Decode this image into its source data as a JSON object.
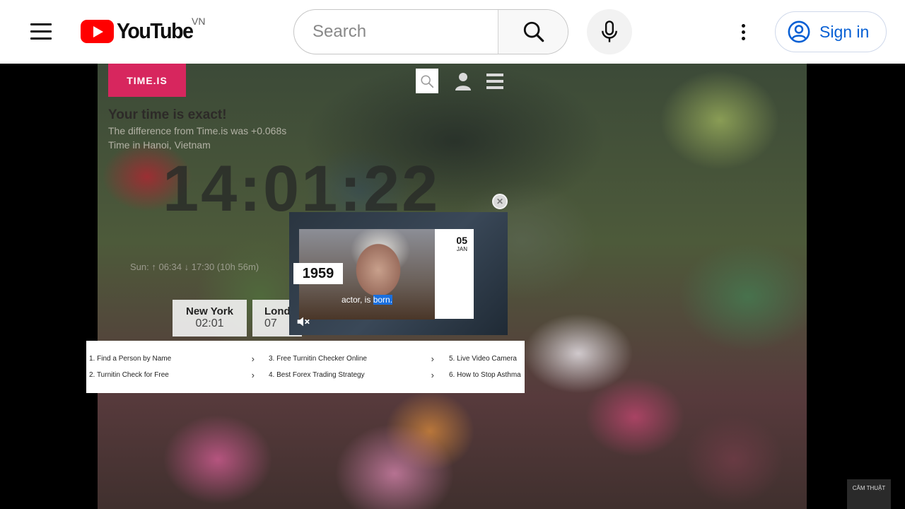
{
  "header": {
    "logo_text": "YouTube",
    "country_code": "VN",
    "search_placeholder": "Search",
    "signin_label": "Sign in"
  },
  "timeis": {
    "logo_label": "TIME.IS",
    "headline": "Your time is exact!",
    "difference_text": "The difference from Time.is was +0.068s",
    "location_text": "Time in Hanoi, Vietnam",
    "clock": "14:01:22",
    "sun_text": "Sun: ↑ 06:34 ↓ 17:30 (10h 56m)",
    "cities": [
      {
        "name": "New York",
        "time": "02:01"
      },
      {
        "name": "London",
        "time": "07:01"
      }
    ]
  },
  "ads": [
    {
      "label": "1. Find a Person by Name"
    },
    {
      "label": "2. Turnitin Check for Free"
    },
    {
      "label": "3. Free Turnitin Checker Online"
    },
    {
      "label": "4. Best Forex Trading Strategy"
    },
    {
      "label": "5. Live Video Camera"
    },
    {
      "label": "6. How to Stop Asthma"
    }
  ],
  "mini_player": {
    "day": "05",
    "month": "JAN",
    "year": "1959",
    "caption_prefix": "actor, is ",
    "caption_highlight": "born."
  },
  "watermark_text": "CÂM THUẬT",
  "colors": {
    "youtube_red": "#ff0000",
    "timeis_pink": "#d7265e",
    "link_blue": "#065fd4"
  },
  "icons": [
    "menu-icon",
    "search-icon",
    "mic-icon",
    "more-vert-icon",
    "account-circle-icon",
    "user-icon",
    "mute-icon",
    "close-icon",
    "chevron-right-icon"
  ]
}
